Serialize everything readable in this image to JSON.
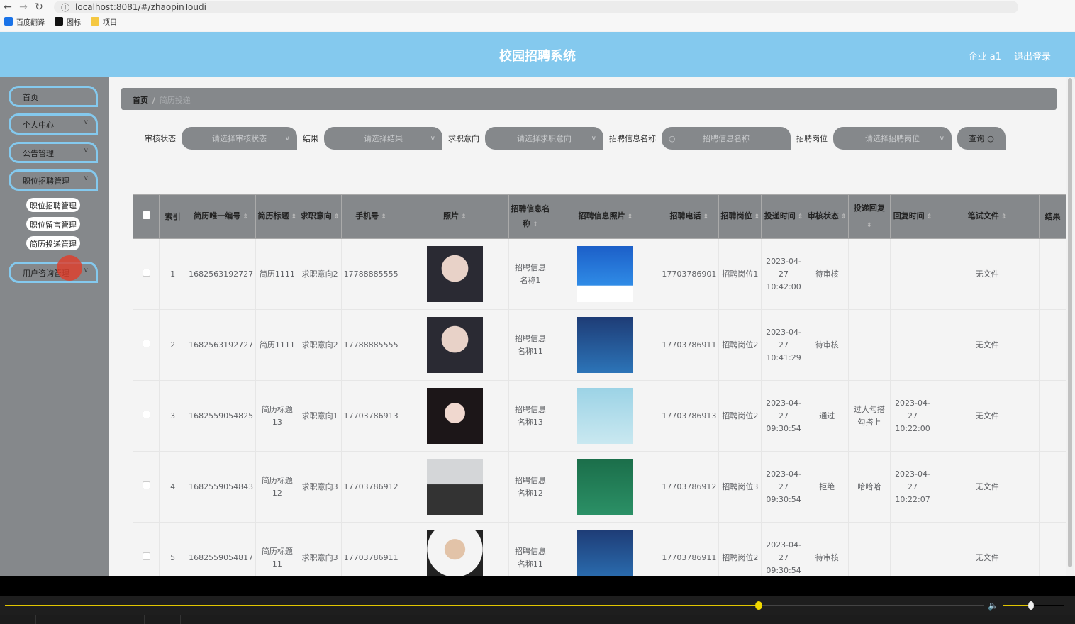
{
  "browser": {
    "url": "localhost:8081/#/zhaopinToudi",
    "bookmarks": [
      "百度翻译",
      "图标",
      "项目"
    ],
    "bookmark_colors": [
      "#1a73e8",
      "#111111",
      "#f5c842"
    ]
  },
  "header": {
    "title": "校园招聘系统",
    "user": "企业 a1",
    "logout": "退出登录",
    "color": "#84c9ee"
  },
  "sidebar": {
    "items": [
      {
        "label": "首页",
        "chev": false
      },
      {
        "label": "个人中心",
        "chev": true
      },
      {
        "label": "公告管理",
        "chev": true
      },
      {
        "label": "职位招聘管理",
        "chev": true
      },
      {
        "label": "用户咨询管理",
        "chev": true
      }
    ],
    "subitems": [
      "职位招聘管理",
      "职位留言管理",
      "简历投递管理"
    ]
  },
  "breadcrumb": {
    "home": "首页",
    "current": "简历投递"
  },
  "filters": [
    {
      "label": "审核状态",
      "placeholder": "请选择审核状态",
      "type": "select"
    },
    {
      "label": "结果",
      "placeholder": "请选择结果",
      "type": "select"
    },
    {
      "label": "求职意向",
      "placeholder": "请选择求职意向",
      "type": "select"
    },
    {
      "label": "招聘信息名称",
      "placeholder": "招聘信息名称",
      "type": "input"
    },
    {
      "label": "招聘岗位",
      "placeholder": "请选择招聘岗位",
      "type": "select"
    }
  ],
  "query_button": "查询",
  "table": {
    "columns": [
      {
        "label": "",
        "w": 39
      },
      {
        "label": "索引",
        "w": 40
      },
      {
        "label": "简历唯一编号",
        "w": 64,
        "sort": true
      },
      {
        "label": "简历标题",
        "w": 63,
        "sort": true
      },
      {
        "label": "求职意向",
        "w": 64,
        "sort": true
      },
      {
        "label": "手机号",
        "w": 63,
        "sort": true
      },
      {
        "label": "照片",
        "w": 159,
        "sort": true
      },
      {
        "label": "招聘信息名称",
        "w": 64,
        "sort": true
      },
      {
        "label": "招聘信息照片",
        "w": 158,
        "sort": true
      },
      {
        "label": "招聘电话",
        "w": 63,
        "sort": true
      },
      {
        "label": "招聘岗位",
        "w": 64,
        "sort": true
      },
      {
        "label": "投递时间",
        "w": 63,
        "sort": true
      },
      {
        "label": "审核状态",
        "w": 64,
        "sort": true
      },
      {
        "label": "投递回复",
        "w": 63,
        "sort": true
      },
      {
        "label": "回复时间",
        "w": 64,
        "sort": true
      },
      {
        "label": "笔试文件",
        "w": 159,
        "sort": true
      },
      {
        "label": "结果",
        "w": 40
      }
    ],
    "rows": [
      [
        "1",
        "1682563192727",
        "简历1111",
        "求职意向2",
        "17788885555",
        "photo-woman",
        "招聘信息名称1",
        "poster-zhaopin",
        "17703786901",
        "招聘岗位1",
        "2023-04-27 10:42:00",
        "待审核",
        "",
        "",
        "无文件",
        ""
      ],
      [
        "2",
        "1682563192727",
        "简历1111",
        "求职意向2",
        "17788885555",
        "photo-woman",
        "招聘信息名称11",
        "poster-zhaopinhui",
        "17703786911",
        "招聘岗位2",
        "2023-04-27 10:41:29",
        "待审核",
        "",
        "",
        "无文件",
        ""
      ],
      [
        "3",
        "1682559054825",
        "简历标题13",
        "求职意向1",
        "17703786913",
        "photo-girl",
        "招聘信息名称13",
        "poster-light",
        "17703786913",
        "招聘岗位2",
        "2023-04-27 09:30:54",
        "通过",
        "过大勾搭勾搭上",
        "2023-04-27 10:22:00",
        "无文件",
        ""
      ],
      [
        "4",
        "1682559054843",
        "简历标题12",
        "求职意向3",
        "17703786912",
        "photo-man-suit",
        "招聘信息名称12",
        "poster-weneedyou",
        "17703786912",
        "招聘岗位3",
        "2023-04-27 09:30:54",
        "拒绝",
        "哈哈哈",
        "2023-04-27 10:22:07",
        "无文件",
        ""
      ],
      [
        "5",
        "1682559054817",
        "简历标题11",
        "求职意向3",
        "17703786911",
        "photo-man",
        "招聘信息名称11",
        "poster-zhaopinhui",
        "17703786911",
        "招聘岗位2",
        "2023-04-27 09:30:54",
        "待审核",
        "",
        "",
        "无文件",
        ""
      ]
    ]
  },
  "player": {
    "progress": 0.77,
    "volume": 0.45
  }
}
